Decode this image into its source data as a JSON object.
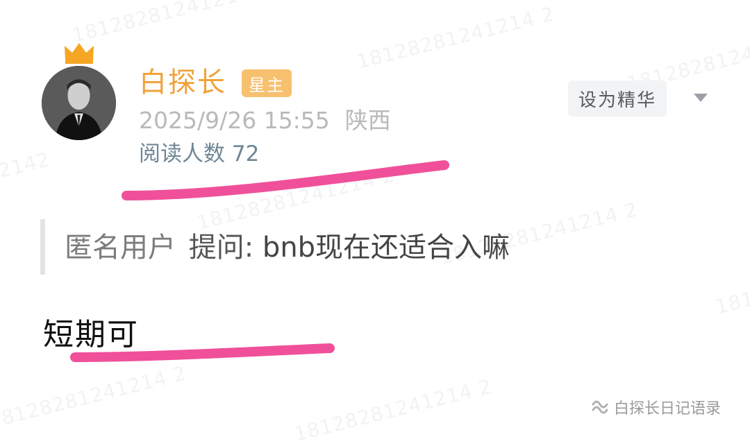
{
  "watermark": {
    "text": "18128281241214 2"
  },
  "author": {
    "name": "白探长",
    "badge": "星主",
    "timestamp": "2025/9/26 15:55",
    "location": "陕西",
    "reads_label": "阅读人数 72",
    "avatar_icon": "crown-icon"
  },
  "actions": {
    "feature_label": "设为精华",
    "more_icon": "triangle-down-icon"
  },
  "post": {
    "asker": "匿名用户",
    "question_prefix": "提问:",
    "question_text": "bnb现在还适合入嘛",
    "answer": "短期可"
  },
  "footer": {
    "label": "白探长日记语录",
    "icon": "wechat-channel-icon"
  },
  "colors": {
    "accent": "#f0a23a",
    "badge_bg": "#f7c06f",
    "highlight": "#f0509a"
  }
}
